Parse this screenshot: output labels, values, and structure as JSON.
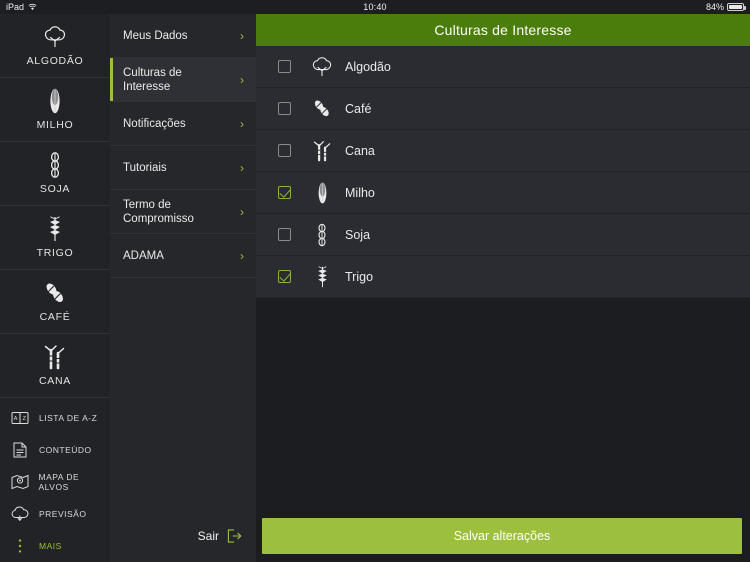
{
  "status_bar": {
    "device": "iPad",
    "wifi_icon": "wifi-icon",
    "time": "10:40",
    "battery_percent": "84%",
    "battery_icon": "battery-icon"
  },
  "colors": {
    "header_green": "#4b7d0d",
    "accent_green": "#9dbf3e",
    "rail_bg": "#222327",
    "menu_bg": "#26272b",
    "row_bg": "#2b2c31",
    "page_bg": "#1c1d21"
  },
  "rail": {
    "crops": [
      {
        "label": "ALGODÃO",
        "icon": "cotton-icon"
      },
      {
        "label": "MILHO",
        "icon": "corn-icon"
      },
      {
        "label": "SOJA",
        "icon": "soy-icon"
      },
      {
        "label": "TRIGO",
        "icon": "wheat-icon"
      },
      {
        "label": "CAFÉ",
        "icon": "coffee-bean-icon"
      },
      {
        "label": "CANA",
        "icon": "sugarcane-icon"
      }
    ],
    "links": [
      {
        "label": "LISTA DE A-Z",
        "icon": "az-book-icon",
        "active": false
      },
      {
        "label": "CONTEÚDO",
        "icon": "document-icon",
        "active": false
      },
      {
        "label": "MAPA DE ALVOS",
        "icon": "target-map-icon",
        "active": false
      },
      {
        "label": "PREVISÃO",
        "icon": "cloud-forecast-icon",
        "active": false
      },
      {
        "label": "MAIS",
        "icon": "more-dots-icon",
        "active": true
      }
    ]
  },
  "menu": {
    "items": [
      {
        "label": "Meus Dados",
        "selected": false,
        "chevron": "chevron-right-icon"
      },
      {
        "label": "Culturas de Interesse",
        "selected": true,
        "chevron": "chevron-right-icon"
      },
      {
        "label": "Notificações",
        "selected": false,
        "chevron": "chevron-right-icon"
      },
      {
        "label": "Tutoriais",
        "selected": false,
        "chevron": "chevron-right-icon"
      },
      {
        "label": "Termo de Compromisso",
        "selected": false,
        "chevron": "chevron-right-icon"
      },
      {
        "label": "ADAMA",
        "selected": false,
        "chevron": "chevron-right-icon"
      }
    ],
    "logout_label": "Sair",
    "logout_icon": "logout-icon"
  },
  "main": {
    "title": "Culturas de Interesse",
    "rows": [
      {
        "name": "Algodão",
        "icon": "cotton-icon",
        "checked": false
      },
      {
        "name": "Café",
        "icon": "coffee-bean-icon",
        "checked": false
      },
      {
        "name": "Cana",
        "icon": "sugarcane-icon",
        "checked": false
      },
      {
        "name": "Milho",
        "icon": "corn-icon",
        "checked": true
      },
      {
        "name": "Soja",
        "icon": "soy-icon",
        "checked": false
      },
      {
        "name": "Trigo",
        "icon": "wheat-icon",
        "checked": true
      }
    ],
    "save_label": "Salvar alterações"
  }
}
